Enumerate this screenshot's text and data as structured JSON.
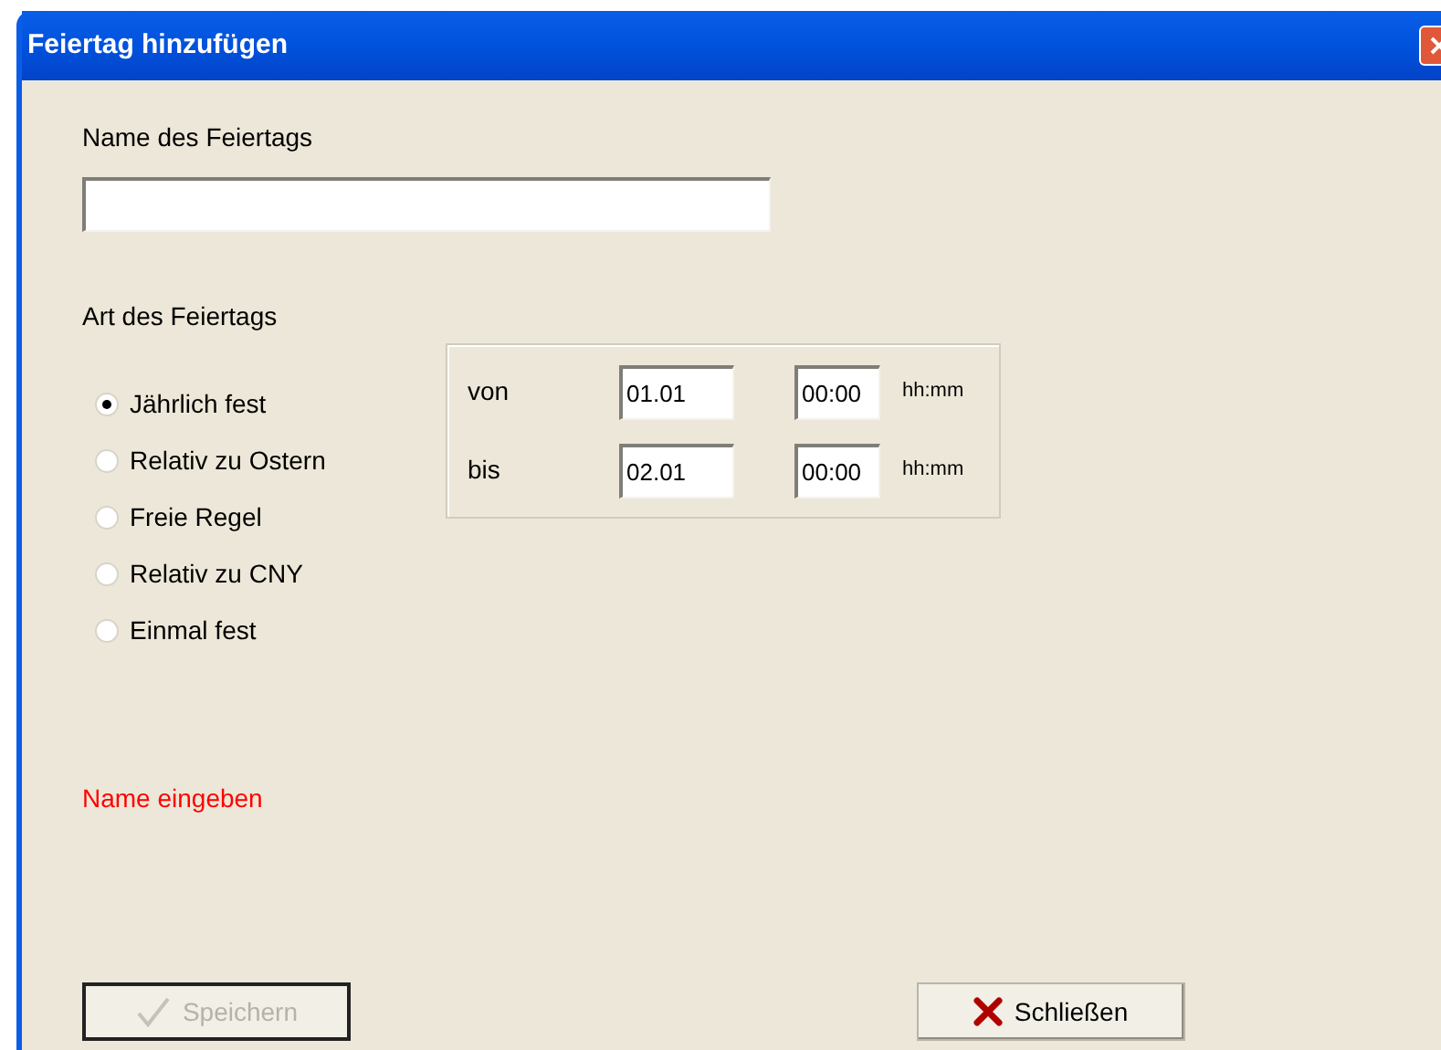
{
  "window": {
    "title": "Feiertag hinzufügen"
  },
  "name_field": {
    "label": "Name des Feiertags"
  },
  "type_label": "Art des Feiertags",
  "types": [
    {
      "label": "Jährlich fest",
      "selected": true
    },
    {
      "label": "Relativ zu Ostern",
      "selected": false
    },
    {
      "label": "Freie Regel",
      "selected": false
    },
    {
      "label": "Relativ zu CNY",
      "selected": false
    },
    {
      "label": "Einmal fest",
      "selected": false
    }
  ],
  "range": [
    {
      "label": "von",
      "date": "01.01",
      "time": "00:00",
      "unit": "hh:mm"
    },
    {
      "label": "bis",
      "date": "02.01",
      "time": "00:00",
      "unit": "hh:mm"
    }
  ],
  "message": "Name eingeben",
  "buttons": [
    {
      "label": "Speichern",
      "kind": "save",
      "disabled": true
    },
    {
      "label": "Schließen",
      "kind": "close",
      "disabled": false
    }
  ]
}
